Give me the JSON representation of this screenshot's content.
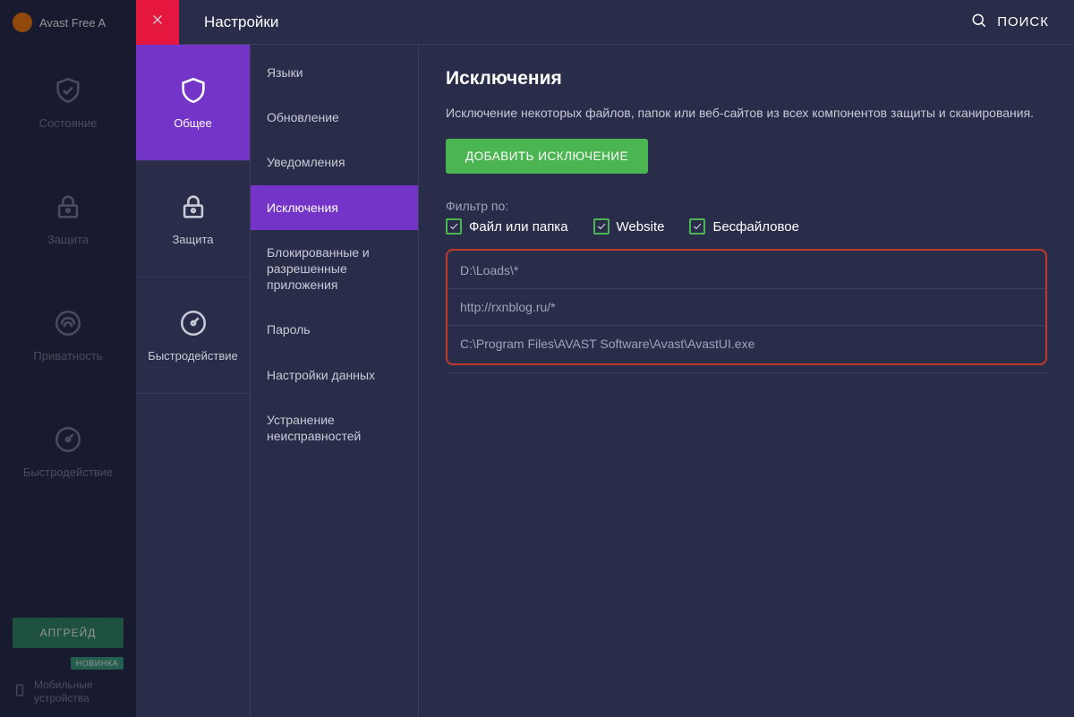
{
  "app": {
    "brand": "Avast Free A"
  },
  "mainnav": {
    "items": [
      {
        "label": "Состояние"
      },
      {
        "label": "Защита"
      },
      {
        "label": "Приватность"
      },
      {
        "label": "Быстродействие"
      }
    ],
    "upgrade": "АПГРЕЙД",
    "badge": "НОВИНКА",
    "mobile": "Мобильные устройства"
  },
  "topbar": {
    "title": "Настройки",
    "search": "ПОИСК"
  },
  "categories": [
    {
      "label": "Общее"
    },
    {
      "label": "Защита"
    },
    {
      "label": "Быстродействие"
    }
  ],
  "subs": [
    {
      "label": "Языки"
    },
    {
      "label": "Обновление"
    },
    {
      "label": "Уведомления"
    },
    {
      "label": "Исключения"
    },
    {
      "label": "Блокированные и разрешенные приложения"
    },
    {
      "label": "Пароль"
    },
    {
      "label": "Настройки данных"
    },
    {
      "label": "Устранение неисправностей"
    }
  ],
  "panel": {
    "heading": "Исключения",
    "desc": "Исключение некоторых файлов, папок или веб-сайтов из всех компонентов защиты и сканирования.",
    "add_btn": "ДОБАВИТЬ ИСКЛЮЧЕНИЕ",
    "filter_label": "Фильтр по:",
    "filters": [
      {
        "label": "Файл или папка",
        "checked": true
      },
      {
        "label": "Website",
        "checked": true
      },
      {
        "label": "Бесфайловое",
        "checked": true
      }
    ],
    "rules": [
      "D:\\Loads\\*",
      "http://rxnblog.ru/*",
      "C:\\Program Files\\AVAST Software\\Avast\\AvastUI.exe"
    ]
  }
}
